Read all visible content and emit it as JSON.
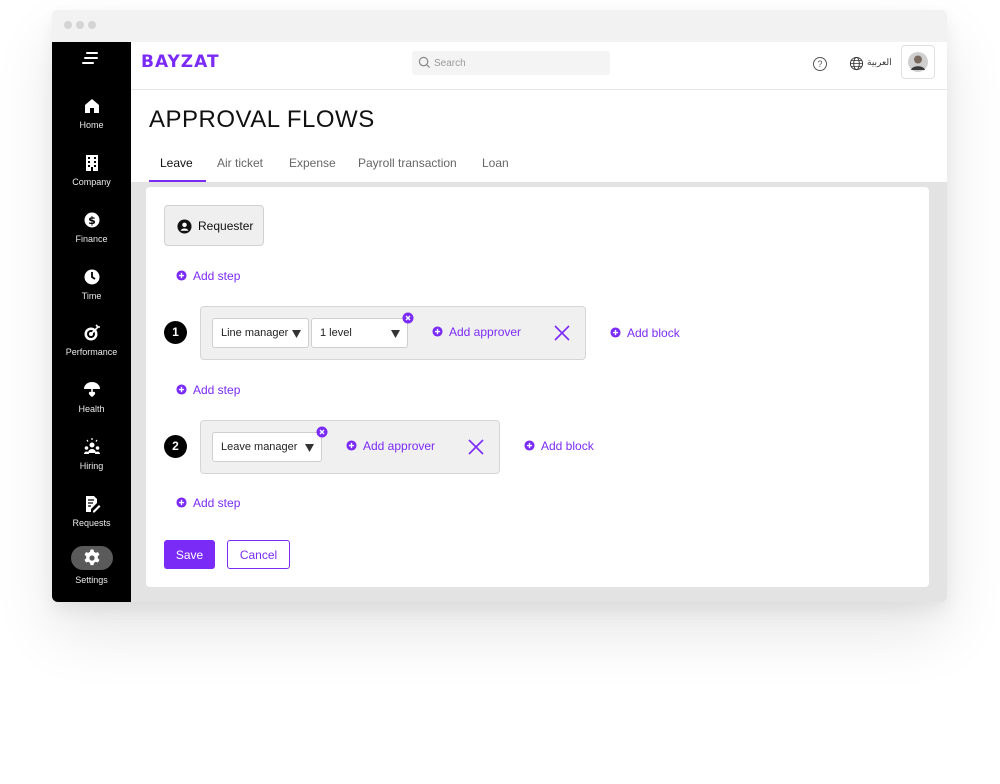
{
  "brand": {
    "logo_text": "BAYZAT",
    "accent": "#7b2bf6"
  },
  "header": {
    "search_placeholder": "Search",
    "help_icon": "question-circle-icon",
    "language_label": "العربية",
    "language_icon": "globe-icon"
  },
  "sidebar": {
    "items": [
      {
        "label": "Home",
        "icon": "home-icon"
      },
      {
        "label": "Company",
        "icon": "building-icon"
      },
      {
        "label": "Finance",
        "icon": "dollar-icon"
      },
      {
        "label": "Time",
        "icon": "clock-icon"
      },
      {
        "label": "Performance",
        "icon": "target-icon"
      },
      {
        "label": "Health",
        "icon": "umbrella-heart-icon"
      },
      {
        "label": "Hiring",
        "icon": "people-icon"
      },
      {
        "label": "Requests",
        "icon": "document-edit-icon"
      },
      {
        "label": "Settings",
        "icon": "gear-icon",
        "active": true
      }
    ]
  },
  "page": {
    "title": "APPROVAL FLOWS",
    "tabs": [
      {
        "label": "Leave",
        "active": true
      },
      {
        "label": "Air ticket"
      },
      {
        "label": "Expense"
      },
      {
        "label": "Payroll transaction"
      },
      {
        "label": "Loan"
      }
    ]
  },
  "flow": {
    "requester_label": "Requester",
    "add_step_label": "Add step",
    "add_approver_label": "Add approver",
    "add_block_label": "Add block",
    "steps": [
      {
        "number": "1",
        "approver": "Line manager",
        "level": "1 level"
      },
      {
        "number": "2",
        "approver": "Leave manager"
      }
    ]
  },
  "actions": {
    "save_label": "Save",
    "cancel_label": "Cancel"
  }
}
